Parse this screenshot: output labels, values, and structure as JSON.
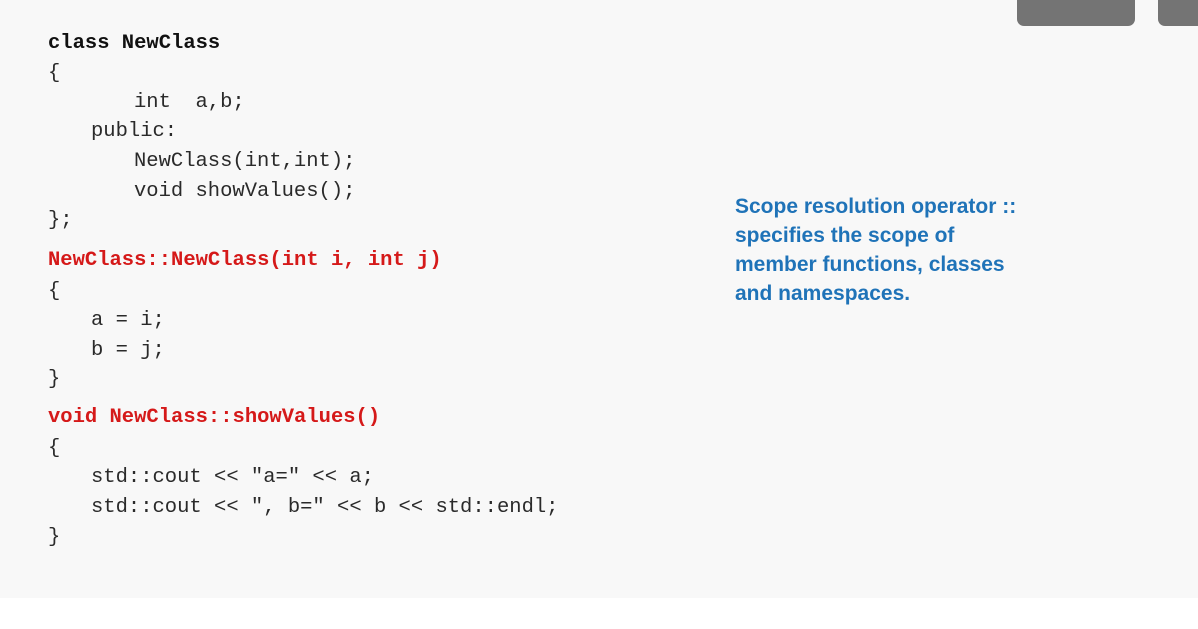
{
  "code": {
    "lines": [
      "class NewClass",
      "{",
      "int  a,b;",
      "public:",
      "NewClass(int,int);",
      "void showValues();",
      "};",
      "NewClass::NewClass(int i, int j)",
      "{",
      "a = i;",
      "b = j;",
      "}",
      "void NewClass::showValues()",
      "{",
      "std::cout << \"a=\" << a;",
      "std::cout << \", b=\" << b << std::endl;",
      "}"
    ]
  },
  "note": {
    "lines": [
      "Scope resolution operator ::",
      "specifies the scope of",
      "member functions, classes",
      "and namespaces."
    ]
  },
  "colors": {
    "highlight": "#d51919",
    "note": "#1f73b8",
    "slide_background": "#f8f8f8",
    "control_gray": "#747474"
  }
}
